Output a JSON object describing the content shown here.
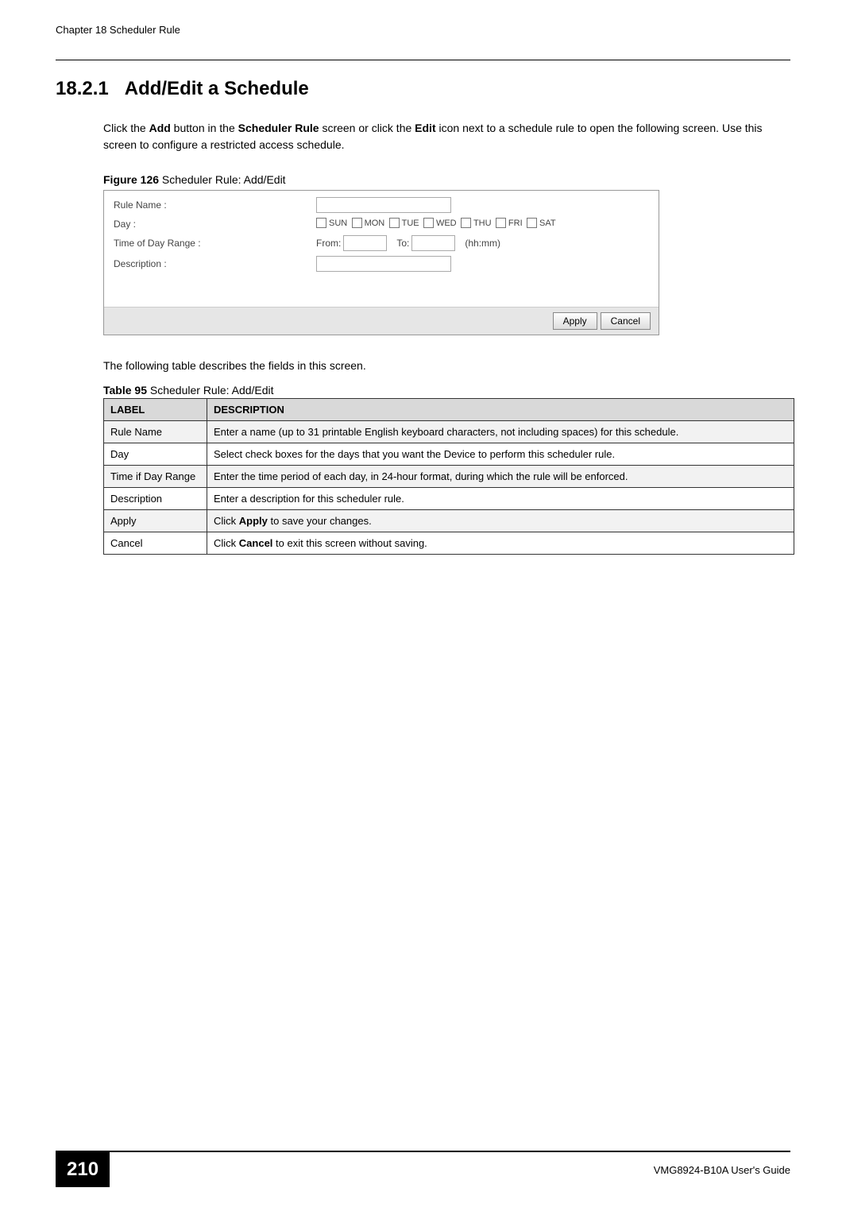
{
  "header": {
    "chapter": "Chapter 18 Scheduler Rule"
  },
  "section": {
    "number": "18.2.1",
    "title": "Add/Edit a Schedule"
  },
  "intro": {
    "part1": "Click the ",
    "bold1": "Add",
    "part2": " button in the ",
    "bold2": "Scheduler Rule",
    "part3": " screen or click the ",
    "bold3": "Edit",
    "part4": " icon next to a schedule rule to open the following screen. Use this screen to configure a restricted access schedule."
  },
  "figure": {
    "caption_bold": "Figure 126",
    "caption_text": "   Scheduler Rule: Add/Edit",
    "form": {
      "rule_name_label": "Rule Name :",
      "day_label": "Day :",
      "time_label": "Time of Day Range :",
      "description_label": "Description :",
      "days": [
        "SUN",
        "MON",
        "TUE",
        "WED",
        "THU",
        "FRI",
        "SAT"
      ],
      "from_label": "From:",
      "to_label": "To:",
      "hhmm": "(hh:mm)"
    },
    "buttons": {
      "apply": "Apply",
      "cancel": "Cancel"
    }
  },
  "post_figure": "The following table describes the fields in this screen.",
  "table": {
    "caption_bold": "Table 95",
    "caption_text": "   Scheduler Rule: Add/Edit",
    "headers": [
      "LABEL",
      "DESCRIPTION"
    ],
    "rows": [
      {
        "label": "Rule Name",
        "desc": "Enter a name (up to 31 printable English keyboard characters, not including spaces) for this schedule."
      },
      {
        "label": "Day",
        "desc": "Select check boxes for the days that you want the Device to perform this scheduler rule."
      },
      {
        "label": "Time if Day Range",
        "desc": "Enter the time period of each day, in 24-hour format, during which the rule will be enforced."
      },
      {
        "label": "Description",
        "desc": "Enter a description for this scheduler rule."
      },
      {
        "label": "Apply",
        "desc_pre": "Click ",
        "desc_bold": "Apply",
        "desc_post": " to save your changes."
      },
      {
        "label": "Cancel",
        "desc_pre": "Click ",
        "desc_bold": "Cancel",
        "desc_post": " to exit this screen without saving."
      }
    ]
  },
  "footer": {
    "page": "210",
    "guide": "VMG8924-B10A User's Guide"
  }
}
